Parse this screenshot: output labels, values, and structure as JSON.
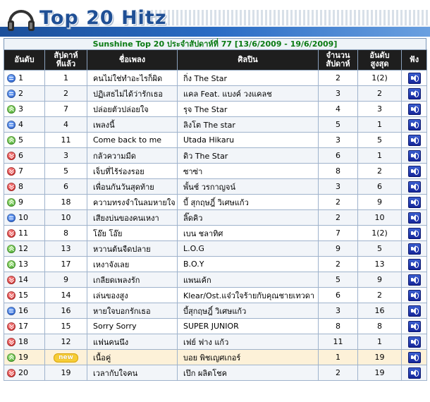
{
  "banner": {
    "title": "Top 20 Hitz"
  },
  "subtitle": "Sunshine Top 20 ประจำสัปดาห์ที่ 77 [13/6/2009 - 19/6/2009]",
  "headers": {
    "rank": "อันดับ",
    "last_week_1": "สัปดาห์",
    "last_week_2": "ที่แล้ว",
    "song": "ชื่อเพลง",
    "artist": "ศิลปิน",
    "weeks_1": "จำนวน",
    "weeks_2": "สัปดาห์",
    "peak_1": "อันดับ",
    "peak_2": "สูงสุด",
    "listen": "ฟัง"
  },
  "colors": {
    "header_bg": "#1e1e1e",
    "title_green": "#0a7a12",
    "banner_blue": "#1f4f95"
  },
  "rows": [
    {
      "rank": "1",
      "trend": "same",
      "last_week": "1",
      "song": "คนไม่ใช่ทำอะไรก็ผิด",
      "artist": "กิ่ง The Star",
      "weeks": "2",
      "peak": "1(2)"
    },
    {
      "rank": "2",
      "trend": "same",
      "last_week": "2",
      "song": "ปฏิเสธไม่ได้ว่ารักเธอ",
      "artist": "แคล Feat. แบงค์ วงแคลช",
      "weeks": "3",
      "peak": "2"
    },
    {
      "rank": "3",
      "trend": "up",
      "last_week": "7",
      "song": "ปล่อยตัวปล่อยใจ",
      "artist": "รุจ The Star",
      "weeks": "4",
      "peak": "3"
    },
    {
      "rank": "4",
      "trend": "same",
      "last_week": "4",
      "song": "เพลงนี้",
      "artist": "ลิงโต The star",
      "weeks": "5",
      "peak": "1"
    },
    {
      "rank": "5",
      "trend": "up",
      "last_week": "11",
      "song": "Come back to me",
      "artist": "Utada Hikaru",
      "weeks": "3",
      "peak": "5"
    },
    {
      "rank": "6",
      "trend": "down",
      "last_week": "3",
      "song": "กลัวความมืด",
      "artist": "ดิว The Star",
      "weeks": "6",
      "peak": "1"
    },
    {
      "rank": "7",
      "trend": "down",
      "last_week": "5",
      "song": "เจ็บที่ไร้ร่องรอย",
      "artist": "ซาซ่า",
      "weeks": "8",
      "peak": "2"
    },
    {
      "rank": "8",
      "trend": "down",
      "last_week": "6",
      "song": "เพื่อนกันวันสุดท้าย",
      "artist": "พั้นช์ วรกาญจน์",
      "weeks": "3",
      "peak": "6"
    },
    {
      "rank": "9",
      "trend": "up",
      "last_week": "18",
      "song": "ความทรงจำในลมหายใจ",
      "artist": "บี้ สุกฤษฎิ์ วิเศษแก้ว",
      "weeks": "2",
      "peak": "9"
    },
    {
      "rank": "10",
      "trend": "same",
      "last_week": "10",
      "song": "เสียงบ่นของคนเหงา",
      "artist": "ลิ๊ดคิว",
      "weeks": "2",
      "peak": "10"
    },
    {
      "rank": "11",
      "trend": "down",
      "last_week": "8",
      "song": "โอ๊ย โอ๊ย",
      "artist": "เบน ชลาทิศ",
      "weeks": "7",
      "peak": "1(2)"
    },
    {
      "rank": "12",
      "trend": "up",
      "last_week": "13",
      "song": "หวานต้นจืดปลาย",
      "artist": "L.O.G",
      "weeks": "9",
      "peak": "5"
    },
    {
      "rank": "13",
      "trend": "up",
      "last_week": "17",
      "song": "เหงาจังเลย",
      "artist": "B.O.Y",
      "weeks": "2",
      "peak": "13"
    },
    {
      "rank": "14",
      "trend": "down",
      "last_week": "9",
      "song": "เกลียดเพลงรัก",
      "artist": "แพนเค้ก",
      "weeks": "5",
      "peak": "9"
    },
    {
      "rank": "15",
      "trend": "down",
      "last_week": "14",
      "song": "เล่นของสูง",
      "artist": "Klear/Ost.แจ๋วใจร้ายกับคุณชายเทวดา",
      "weeks": "6",
      "peak": "2"
    },
    {
      "rank": "16",
      "trend": "same",
      "last_week": "16",
      "song": "หายใจบอกรักเธอ",
      "artist": "บี้สุกฤษฎิ์ วิเศษแก้ว",
      "weeks": "3",
      "peak": "16"
    },
    {
      "rank": "17",
      "trend": "down",
      "last_week": "15",
      "song": "Sorry Sorry",
      "artist": "SUPER JUNIOR",
      "weeks": "8",
      "peak": "8"
    },
    {
      "rank": "18",
      "trend": "down",
      "last_week": "12",
      "song": "แฟนคนนึง",
      "artist": "เฟย์ ฟาง แก้ว",
      "weeks": "11",
      "peak": "1"
    },
    {
      "rank": "19",
      "trend": "up",
      "last_week": "new",
      "song": "เนื้อคู่",
      "artist": "บอย พิชเญศเกอร์",
      "weeks": "1",
      "peak": "19"
    },
    {
      "rank": "20",
      "trend": "down",
      "last_week": "19",
      "song": "เวลากับใจคน",
      "artist": "เป๊ก ผลิตโชค",
      "weeks": "2",
      "peak": "19"
    }
  ]
}
